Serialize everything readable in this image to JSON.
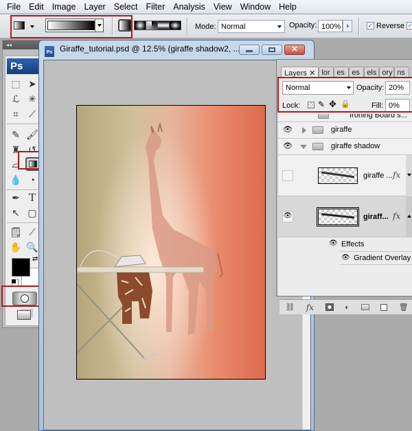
{
  "menubar": {
    "items": [
      "File",
      "Edit",
      "Image",
      "Layer",
      "Select",
      "Filter",
      "Analysis",
      "View",
      "Window",
      "Help"
    ]
  },
  "options_bar": {
    "mode_label": "Mode:",
    "mode_value": "Normal",
    "opacity_label": "Opacity:",
    "opacity_value": "100%",
    "reverse_label": "Reverse",
    "reverse_checked": true,
    "dither_checked": true,
    "gradient_types": [
      "linear",
      "radial",
      "angle",
      "reflected",
      "diamond"
    ],
    "active_gradient_type": "linear"
  },
  "toolbox": {
    "collapse_glyph": "◂◂",
    "logo": "Ps",
    "active_tool": "gradient-tool",
    "quick_mask_highlighted": true
  },
  "document": {
    "title": "Giraffe_tutorial.psd @ 12.5% (giraffe shadow2, ...",
    "zoom": "12.5%"
  },
  "layers_panel": {
    "tabs": [
      "Layers",
      "lor",
      "es",
      "es",
      "els",
      "ory",
      "ns"
    ],
    "blend_mode": "Normal",
    "opacity_label": "Opacity:",
    "opacity_value": "20%",
    "lock_label": "Lock:",
    "fill_label": "Fill:",
    "fill_value": "0%",
    "layers": [
      {
        "name": "Ironing Board s...",
        "type": "group",
        "visible": false,
        "expanded": false
      },
      {
        "name": "giraffe",
        "type": "group",
        "visible": true,
        "expanded": false
      },
      {
        "name": "giraffe shadow",
        "type": "group",
        "visible": true,
        "expanded": true
      },
      {
        "name": "giraffe ...",
        "type": "layer",
        "visible": false,
        "has_fx": true
      },
      {
        "name": "giraff...",
        "type": "layer",
        "visible": true,
        "has_fx": true,
        "selected": true
      }
    ],
    "effects_label": "Effects",
    "effect_item": "Gradient Overlay",
    "fx_glyph": "fx"
  }
}
